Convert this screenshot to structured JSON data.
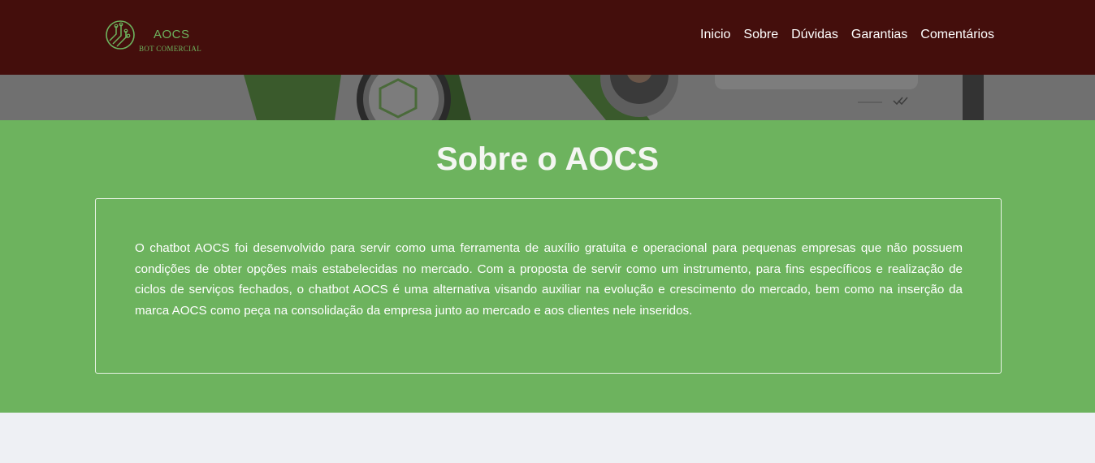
{
  "brand": {
    "name": "AOCS",
    "tagline": "BOT COMERCIAL",
    "icon": "circuit-logo-icon",
    "accent_color": "#6db35e",
    "header_color": "#440e0c"
  },
  "nav": {
    "items": [
      {
        "label": "Inicio"
      },
      {
        "label": "Sobre"
      },
      {
        "label": "Dúvidas"
      },
      {
        "label": "Garantias"
      },
      {
        "label": "Comentários"
      }
    ]
  },
  "hero": {
    "image": "chatbot-illustration"
  },
  "about": {
    "title": "Sobre o AOCS",
    "body": "O chatbot AOCS foi desenvolvido para servir como uma ferramenta de auxílio gratuita e operacional para pequenas empresas que não possuem condições de obter opções mais estabelecidas no mercado. Com a proposta de servir como um instrumento, para fins específicos e realização de ciclos de serviços fechados, o chatbot AOCS é uma alternativa visando auxiliar na evolução e crescimento do mercado, bem como na inserção da marca AOCS como peça na consolidação da empresa junto ao mercado e aos clientes nele inseridos.",
    "background_color": "#6db35e"
  }
}
